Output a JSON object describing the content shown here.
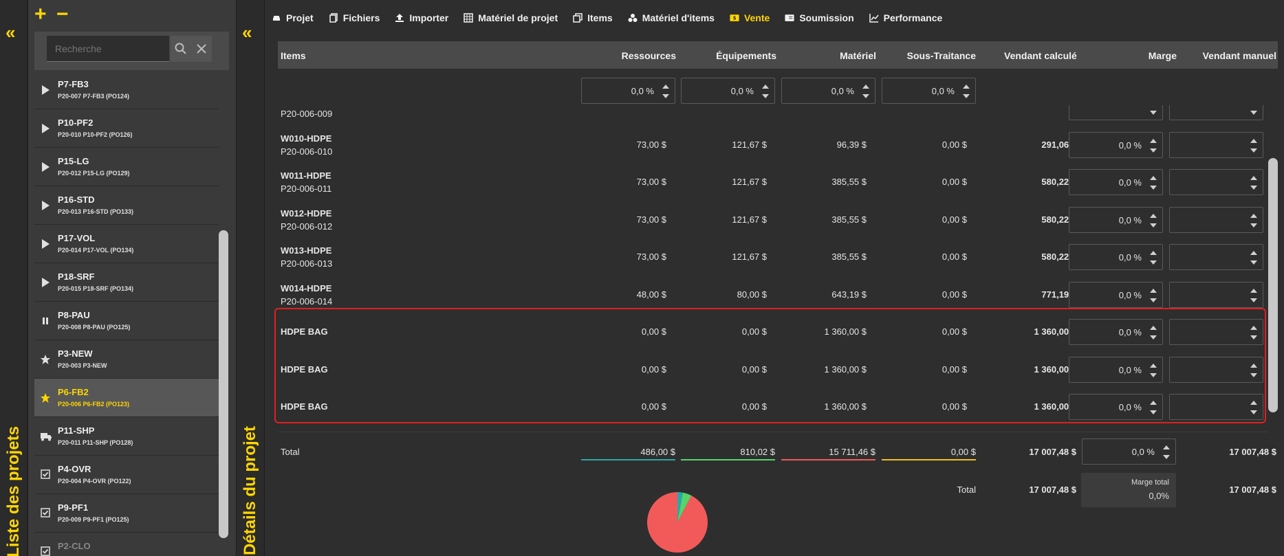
{
  "left_panel": {
    "title": "Liste des projets",
    "add": "+",
    "remove": "−",
    "collapse": "«",
    "search_placeholder": "Recherche",
    "projects": [
      {
        "name": "P7-FB3",
        "sub": "P20-007 P7-FB3 (PO124)",
        "icon": "play-icon"
      },
      {
        "name": "P10-PF2",
        "sub": "P20-010 P10-PF2 (PO126)",
        "icon": "play-icon"
      },
      {
        "name": "P15-LG",
        "sub": "P20-012 P15-LG (PO129)",
        "icon": "play-icon"
      },
      {
        "name": "P16-STD",
        "sub": "P20-013 P16-STD (PO133)",
        "icon": "play-icon"
      },
      {
        "name": "P17-VOL",
        "sub": "P20-014 P17-VOL (PO134)",
        "icon": "play-icon"
      },
      {
        "name": "P18-SRF",
        "sub": "P20-015 P18-SRF (PO134)",
        "icon": "play-icon"
      },
      {
        "name": "P8-PAU",
        "sub": "P20-008 P8-PAU (PO125)",
        "icon": "pause-icon"
      },
      {
        "name": "P3-NEW",
        "sub": "P20-003 P3-NEW",
        "icon": "star-icon"
      },
      {
        "name": "P6-FB2",
        "sub": "P20-006 P6-FB2 (PO123)",
        "icon": "star-icon"
      },
      {
        "name": "P11-SHP",
        "sub": "P20-011 P11-SHP (PO128)",
        "icon": "truck-icon"
      },
      {
        "name": "P4-OVR",
        "sub": "P20-004 P4-OVR (PO122)",
        "icon": "checkbox-icon"
      },
      {
        "name": "P9-PF1",
        "sub": "P20-009 P9-PF1 (PO125)",
        "icon": "checkbox-icon"
      },
      {
        "name": "P2-CLO",
        "sub": "",
        "icon": "checkbox-icon"
      }
    ]
  },
  "details_panel": {
    "title": "Détails du projet",
    "collapse": "«"
  },
  "tabs": [
    {
      "label": "Projet",
      "icon": "car-icon"
    },
    {
      "label": "Fichiers",
      "icon": "files-icon"
    },
    {
      "label": "Importer",
      "icon": "upload-icon"
    },
    {
      "label": "Matériel de projet",
      "icon": "grid-icon"
    },
    {
      "label": "Items",
      "icon": "copy-icon"
    },
    {
      "label": "Matériel d'items",
      "icon": "cubes-icon"
    },
    {
      "label": "Vente",
      "icon": "dollar-icon",
      "active": true
    },
    {
      "label": "Soumission",
      "icon": "invoice-icon"
    },
    {
      "label": "Performance",
      "icon": "chart-icon"
    }
  ],
  "table": {
    "headers": {
      "items": "Items",
      "ressources": "Ressources",
      "equipements": "Équipements",
      "materiel": "Matériel",
      "sous_traitance": "Sous-Traitance",
      "vendant_calcule": "Vendant calculé",
      "marge": "Marge",
      "vendant_manuel": "Vendant manuel"
    },
    "pct": {
      "ressources": "0,0 %",
      "equipements": "0,0 %",
      "materiel": "0,0 %",
      "sous_traitance": "0,0 %"
    },
    "rows": [
      {
        "name": "",
        "code": "P20-006-009",
        "ressources": "",
        "equipements": "",
        "materiel": "",
        "sous_traitance": "",
        "vendant": "",
        "marge": ""
      },
      {
        "name": "W010-HDPE",
        "code": "P20-006-010",
        "ressources": "73,00 $",
        "equipements": "121,67 $",
        "materiel": "96,39 $",
        "sous_traitance": "0,00 $",
        "vendant": "291,06 $",
        "marge": "0,0 %"
      },
      {
        "name": "W011-HDPE",
        "code": "P20-006-011",
        "ressources": "73,00 $",
        "equipements": "121,67 $",
        "materiel": "385,55 $",
        "sous_traitance": "0,00 $",
        "vendant": "580,22 $",
        "marge": "0,0 %"
      },
      {
        "name": "W012-HDPE",
        "code": "P20-006-012",
        "ressources": "73,00 $",
        "equipements": "121,67 $",
        "materiel": "385,55 $",
        "sous_traitance": "0,00 $",
        "vendant": "580,22 $",
        "marge": "0,0 %"
      },
      {
        "name": "W013-HDPE",
        "code": "P20-006-013",
        "ressources": "73,00 $",
        "equipements": "121,67 $",
        "materiel": "385,55 $",
        "sous_traitance": "0,00 $",
        "vendant": "580,22 $",
        "marge": "0,0 %"
      },
      {
        "name": "W014-HDPE",
        "code": "P20-006-014",
        "ressources": "48,00 $",
        "equipements": "80,00 $",
        "materiel": "643,19 $",
        "sous_traitance": "0,00 $",
        "vendant": "771,19 $",
        "marge": "0,0 %"
      },
      {
        "name": "HDPE BAG",
        "code": "",
        "ressources": "0,00 $",
        "equipements": "0,00 $",
        "materiel": "1 360,00 $",
        "sous_traitance": "0,00 $",
        "vendant": "1 360,00 $",
        "marge": "0,0 %"
      },
      {
        "name": "HDPE BAG",
        "code": "",
        "ressources": "0,00 $",
        "equipements": "0,00 $",
        "materiel": "1 360,00 $",
        "sous_traitance": "0,00 $",
        "vendant": "1 360,00 $",
        "marge": "0,0 %"
      },
      {
        "name": "HDPE BAG",
        "code": "",
        "ressources": "0,00 $",
        "equipements": "0,00 $",
        "materiel": "1 360,00 $",
        "sous_traitance": "0,00 $",
        "vendant": "1 360,00 $",
        "marge": "0,0 %"
      }
    ]
  },
  "totals": {
    "label": "Total",
    "ressources": "486,00 $",
    "equipements": "810,02 $",
    "materiel": "15 711,46 $",
    "sous_traitance": "0,00 $",
    "vendant_calcule": "17 007,48 $",
    "marge": "0,0 %",
    "vendant_manuel": "17 007,48 $",
    "total2_label": "Total",
    "total2_calcule": "17 007,48 $",
    "marge_total_label": "Marge total",
    "marge_total_value": "0,0%",
    "total2_manuel": "17 007,48 $"
  },
  "colors": {
    "accent": "#ffd600",
    "ressources_line": "#2aa7a7",
    "equipements_line": "#55d46a",
    "materiel_line": "#f25a5a",
    "sous_traitance_line": "#f0c020",
    "highlight": "#e02020"
  },
  "pie": {
    "slices": [
      {
        "label": "Ressources",
        "value": 486.0,
        "color": "#2aa7a7"
      },
      {
        "label": "Équipements",
        "value": 810.02,
        "color": "#55d46a"
      },
      {
        "label": "Matériel",
        "value": 15711.46,
        "color": "#f25a5a"
      },
      {
        "label": "Sous-Traitance",
        "value": 0.0,
        "color": "#f0c020"
      }
    ]
  }
}
